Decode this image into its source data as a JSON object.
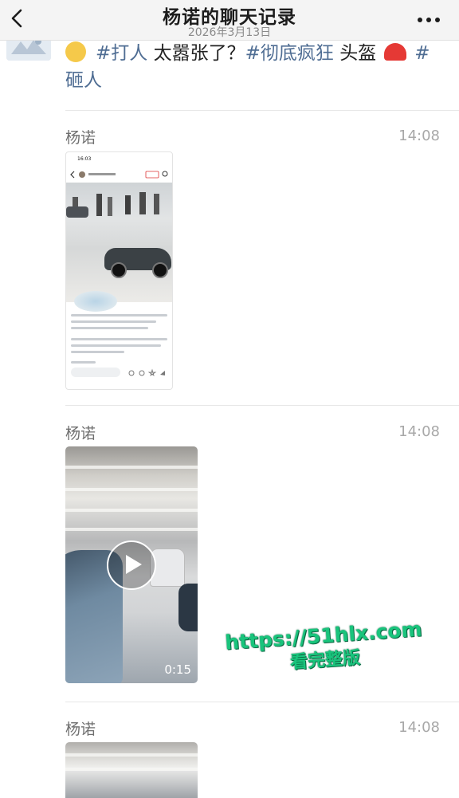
{
  "header": {
    "title": "杨诺的聊天记录",
    "subtitle": "2026年3月13日"
  },
  "icons": {
    "back": "chevron-left-icon",
    "more": "more-dots-icon",
    "play": "play-icon"
  },
  "top_message": {
    "line1_tag1": "#打人",
    "line1_text": "太嚣张了？",
    "line1_tag2": "#彻底疯狂",
    "line1_text2": "头盔",
    "line1_tag3": "#",
    "line2_tag": "砸人"
  },
  "messages": [
    {
      "sender": "杨诺",
      "time": "14:08",
      "type": "image",
      "shot_status": "16:03"
    },
    {
      "sender": "杨诺",
      "time": "14:08",
      "type": "video",
      "duration": "0:15"
    },
    {
      "sender": "杨诺",
      "time": "14:08",
      "type": "video"
    }
  ],
  "watermark": {
    "url": "https://51hlx.com",
    "text": "看完整版"
  },
  "colors": {
    "hashtag": "#4f6d93",
    "watermark": "#19c47c",
    "header_bg": "#f4f4f4"
  }
}
